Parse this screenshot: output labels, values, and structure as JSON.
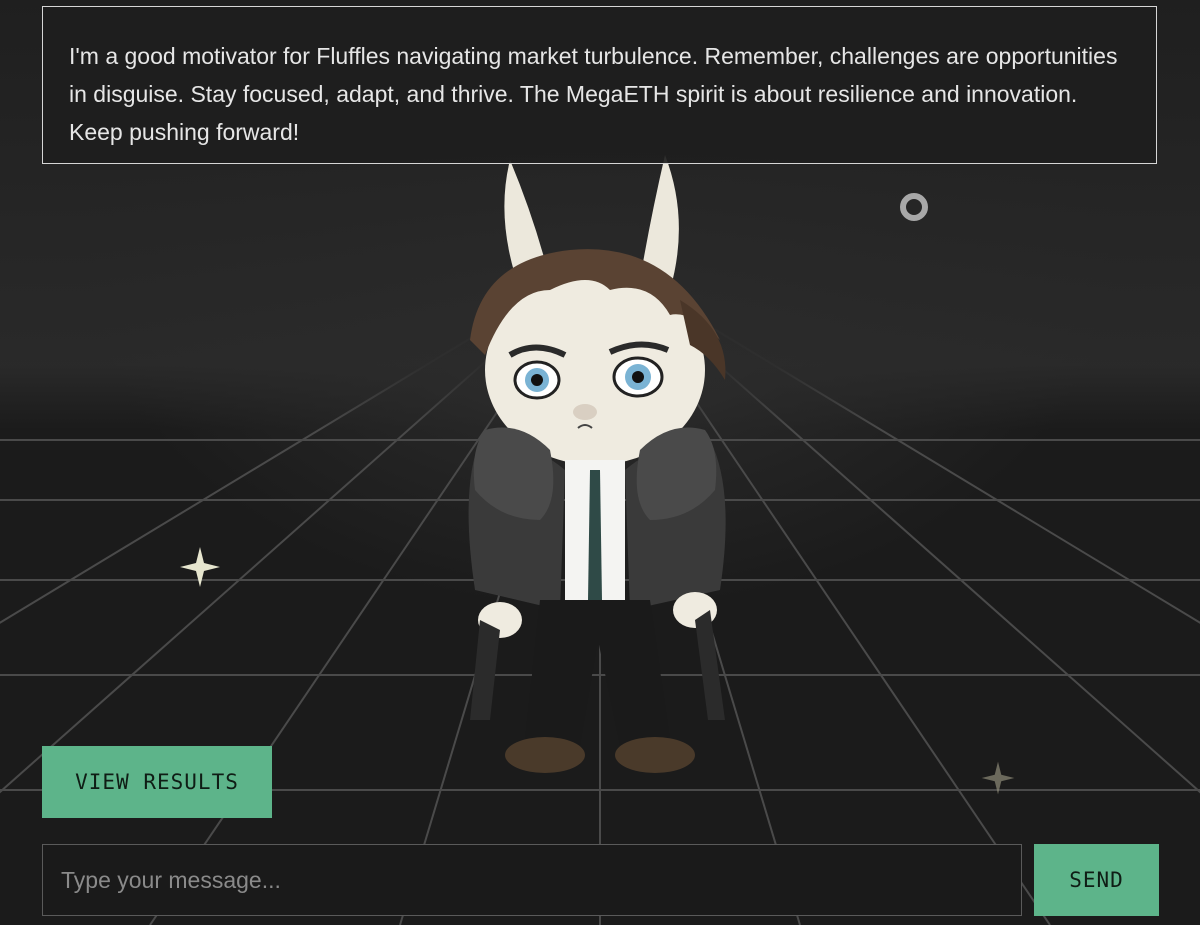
{
  "speech": {
    "text": "I'm a good motivator for Fluffles navigating market turbulence. Remember, challenges are opportunities in disguise. Stay focused, adapt, and thrive. The MegaETH spirit is about resilience and innovation. Keep pushing forward!"
  },
  "scene": {
    "character_icon": "bunny-character-icon",
    "sparkle_icon": "sparkle-icon",
    "ring_icon": "ring-icon"
  },
  "actions": {
    "view_results_label": "VIEW RESULTS",
    "send_label": "SEND"
  },
  "chat": {
    "placeholder": "Type your message...",
    "value": ""
  },
  "colors": {
    "accent": "#5db48a",
    "background": "#1d1d1d",
    "border": "#d6d6d6"
  }
}
